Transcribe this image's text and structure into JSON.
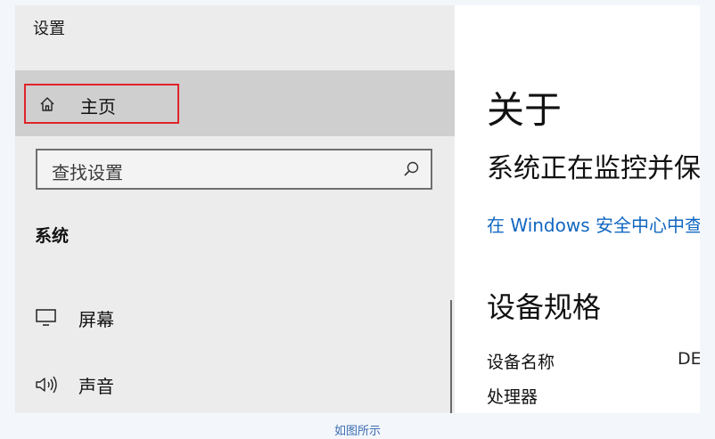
{
  "window": {
    "title": "设置"
  },
  "sidebar": {
    "home": {
      "label": "主页",
      "icon": "home-icon"
    },
    "search": {
      "placeholder": "查找设置",
      "icon": "search-icon"
    },
    "section_title": "系统",
    "items": [
      {
        "label": "屏幕",
        "icon": "display-icon"
      },
      {
        "label": "声音",
        "icon": "speaker-icon"
      }
    ]
  },
  "content": {
    "title": "关于",
    "protection_text": "系统正在监控并保",
    "security_link": "在 Windows 安全中心中查",
    "specs_title": "设备规格",
    "device_name_label": "设备名称",
    "device_name_value": "DE",
    "processor_label": "处理器"
  },
  "caption": "如图所示",
  "colors": {
    "sidebar_bg": "#ececec",
    "selected_bg": "#cfcfcf",
    "highlight_border": "#e0242a",
    "link": "#1167c1",
    "caption": "#3d6fb3"
  }
}
